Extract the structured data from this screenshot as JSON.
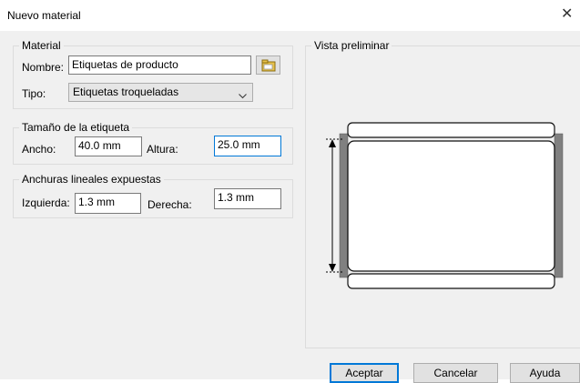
{
  "window": {
    "title": "Nuevo material",
    "close_glyph": "✕"
  },
  "material": {
    "legend": "Material",
    "name_label": "Nombre:",
    "name_value": "Etiquetas de producto",
    "browse_icon": "folder-icon",
    "type_label": "Tipo:",
    "type_value": "Etiquetas troqueladas"
  },
  "label_size": {
    "legend": "Tamaño de la etiqueta",
    "width_label": "Ancho:",
    "width_value": "40.0 mm",
    "height_label": "Altura:",
    "height_value": "25.0 mm"
  },
  "liner": {
    "legend": "Anchuras lineales expuestas",
    "left_label": "Izquierda:",
    "left_value": "1.3 mm",
    "right_label": "Derecha:",
    "right_value": "1.3 mm"
  },
  "preview": {
    "legend": "Vista preliminar"
  },
  "buttons": {
    "accept": "Aceptar",
    "cancel": "Cancelar",
    "help": "Ayuda"
  },
  "colors": {
    "dialog_bg": "#f0f0f0",
    "focus_border": "#0078d7",
    "liner_gray": "#808080"
  }
}
